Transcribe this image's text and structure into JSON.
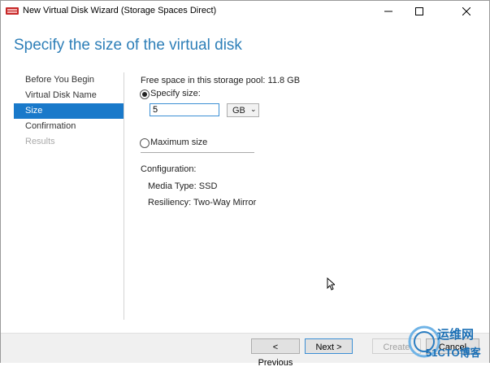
{
  "window": {
    "title": "New Virtual Disk Wizard (Storage Spaces Direct)"
  },
  "heading": "Specify the size of the virtual disk",
  "sidebar": {
    "items": [
      {
        "label": "Before You Begin",
        "state": "normal"
      },
      {
        "label": "Virtual Disk Name",
        "state": "normal"
      },
      {
        "label": "Size",
        "state": "active"
      },
      {
        "label": "Confirmation",
        "state": "normal"
      },
      {
        "label": "Results",
        "state": "disabled"
      }
    ]
  },
  "content": {
    "free_space": "Free space in this storage pool: 11.8 GB",
    "specify_size_label": "Specify size:",
    "size_value": "5",
    "unit": "GB",
    "maximum_size_label": "Maximum size",
    "configuration_label": "Configuration:",
    "media_type": "Media Type: SSD",
    "resiliency": "Resiliency: Two-Way Mirror"
  },
  "footer": {
    "previous_label": "< Previous",
    "next_label": "Next >",
    "create_label": "Create",
    "cancel_label": "Cancel"
  },
  "watermark": {
    "line1": "运维网",
    "line2": "51CTO博客"
  },
  "colors": {
    "accent": "#1979ca",
    "heading": "#2e7fb8"
  }
}
